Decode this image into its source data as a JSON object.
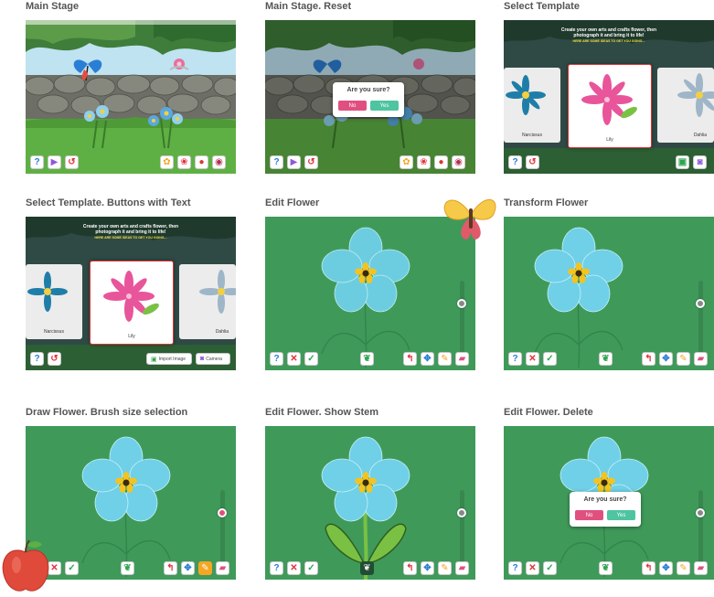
{
  "panels": [
    {
      "title": "Main Stage"
    },
    {
      "title": "Main Stage. Reset"
    },
    {
      "title": "Select Template"
    },
    {
      "title": "Select Template. Buttons with Text"
    },
    {
      "title": "Edit Flower"
    },
    {
      "title": "Transform Flower"
    },
    {
      "title": "Draw Flower. Brush size selection"
    },
    {
      "title": "Edit Flower. Show Stem"
    },
    {
      "title": "Edit Flower. Delete"
    }
  ],
  "dialog": {
    "question": "Are you sure?",
    "no": "No",
    "yes": "Yes"
  },
  "template": {
    "headline1": "Create your own arts and crafts flower, then",
    "headline2": "photograph it and bring it to life!",
    "subline": "HERE ARE SOME IDEAS TO GET YOU GOING...",
    "cards": [
      "Narcissus",
      "Lily",
      "Dahlia"
    ],
    "import_label": "Import Image",
    "camera_label": "Camera"
  },
  "colors": {
    "sky": "#bfe3f0",
    "wall": "#6d6f66",
    "grass": "#5fb044",
    "edit_bg": "#3f9a5a",
    "template_bg": "#2f4a45",
    "petal": "#6fd0e8",
    "accent_orange": "#f5a623",
    "knob_pink": "#e0507e"
  },
  "icons": [
    "help-icon",
    "play-icon",
    "reset-icon",
    "butterfly-icon",
    "flower-icon",
    "apple-icon",
    "ball-icon",
    "close-icon",
    "check-icon",
    "stem-icon",
    "undo-icon",
    "move-icon",
    "brush-icon",
    "eraser-icon",
    "image-icon",
    "camera-icon"
  ]
}
